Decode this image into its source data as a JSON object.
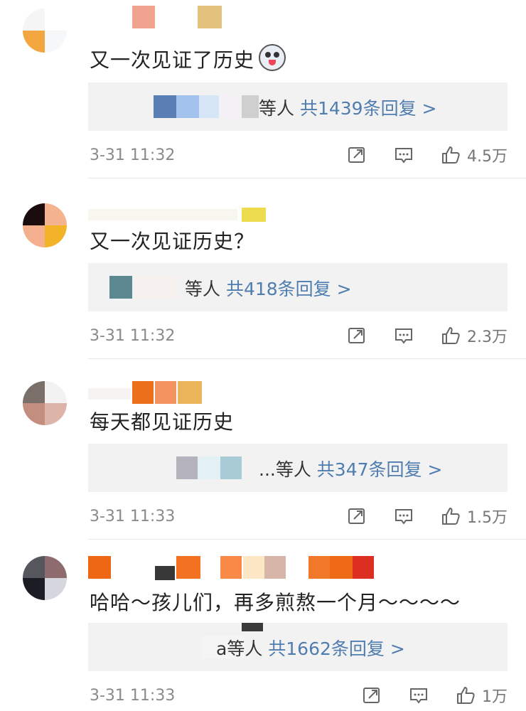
{
  "comments": [
    {
      "text": "又一次见证了历史",
      "reply_prefix": "等人",
      "reply_count": "共1439条回复 >",
      "time": "3-31 11:32",
      "likes": "4.5万"
    },
    {
      "text": "又一次见证历史？",
      "reply_prefix": "等人",
      "reply_count": "共418条回复 >",
      "time": "3-31 11:32",
      "likes": "2.3万"
    },
    {
      "text": "每天都见证历史",
      "reply_prefix": "...等人",
      "reply_count": "共347条回复 >",
      "time": "3-31 11:33",
      "likes": "1.5万"
    },
    {
      "text": "哈哈～孩儿们，再多煎熬一个月～～～～",
      "reply_prefix": "a等人",
      "reply_count": "共1662条回复 >",
      "time": "3-31 11:33",
      "likes": "1万"
    }
  ],
  "icons": {
    "forward": "share-icon",
    "comment": "comment-icon",
    "like": "thumbs-up-icon"
  },
  "colors": {
    "link": "#507daf",
    "meta": "#8a8a8a",
    "reply_bg": "#f2f2f2"
  }
}
